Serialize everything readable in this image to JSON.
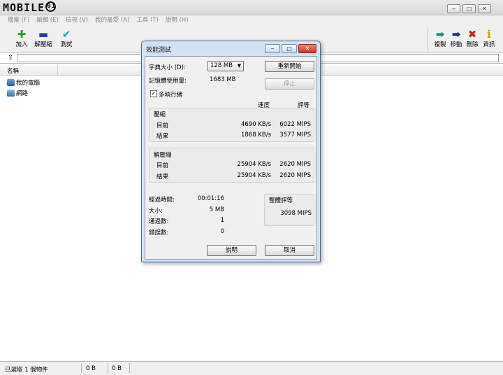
{
  "window": {
    "logo_text": "MOBILE",
    "logo_badge": "01",
    "min": "‒",
    "max": "□",
    "close": "✕"
  },
  "menu": [
    "檔案 (F)",
    "編輯 (E)",
    "檢視 (V)",
    "我的最愛 (A)",
    "工具 (T)",
    "說明 (H)"
  ],
  "toolbar_left": [
    {
      "label": "加入",
      "icon": "add-icon",
      "glyph": "✚",
      "color": "#2ca02c"
    },
    {
      "label": "解壓縮",
      "icon": "extract-icon",
      "glyph": "▬",
      "color": "#1f3fa0"
    },
    {
      "label": "測試",
      "icon": "test-icon",
      "glyph": "✔",
      "color": "#2aa0b8"
    }
  ],
  "toolbar_right": [
    {
      "label": "複製",
      "icon": "copy-icon",
      "glyph": "➡",
      "color": "#1f8a7a"
    },
    {
      "label": "移動",
      "icon": "move-icon",
      "glyph": "➡",
      "color": "#1f2a80"
    },
    {
      "label": "刪除",
      "icon": "delete-icon",
      "glyph": "✖",
      "color": "#c8201a"
    },
    {
      "label": "資訊",
      "icon": "info-icon",
      "glyph": "ℹ",
      "color": "#c8a000"
    }
  ],
  "address": {
    "up_glyph": "⇧",
    "value": ""
  },
  "list": {
    "column_name": "名稱",
    "items": [
      "我的電腦",
      "網路"
    ]
  },
  "status": {
    "selected": "已選取 1 個物件",
    "size1": "0 B",
    "size2": "0 B"
  },
  "dialog": {
    "title": "效能測試",
    "dict_label": "字典大小 (D):",
    "dict_value": "128 MB",
    "mem_label": "記憶體使用量:",
    "mem_value": "1683 MB",
    "restart": "重新開始",
    "stop": "停止",
    "multithread": "多執行緒",
    "col_speed": "速度",
    "col_rating": "評等",
    "compress": {
      "title": "壓縮",
      "rows": [
        {
          "label": "目前",
          "speed": "4690 KB/s",
          "rating": "6022 MIPS"
        },
        {
          "label": "結果",
          "speed": "1868 KB/s",
          "rating": "3577 MIPS"
        }
      ]
    },
    "decompress": {
      "title": "解壓縮",
      "rows": [
        {
          "label": "目前",
          "speed": "25904 KB/s",
          "rating": "2620 MIPS"
        },
        {
          "label": "結果",
          "speed": "25904 KB/s",
          "rating": "2620 MIPS"
        }
      ]
    },
    "elapsed_label": "經過時間:",
    "elapsed_value": "00:01:16",
    "size_label": "大小:",
    "size_value": "5 MB",
    "passes_label": "通過數:",
    "passes_value": "1",
    "errors_label": "錯誤數:",
    "errors_value": "0",
    "overall_label": "整體評等",
    "overall_value": "3098 MIPS",
    "help": "說明",
    "cancel": "取消"
  }
}
